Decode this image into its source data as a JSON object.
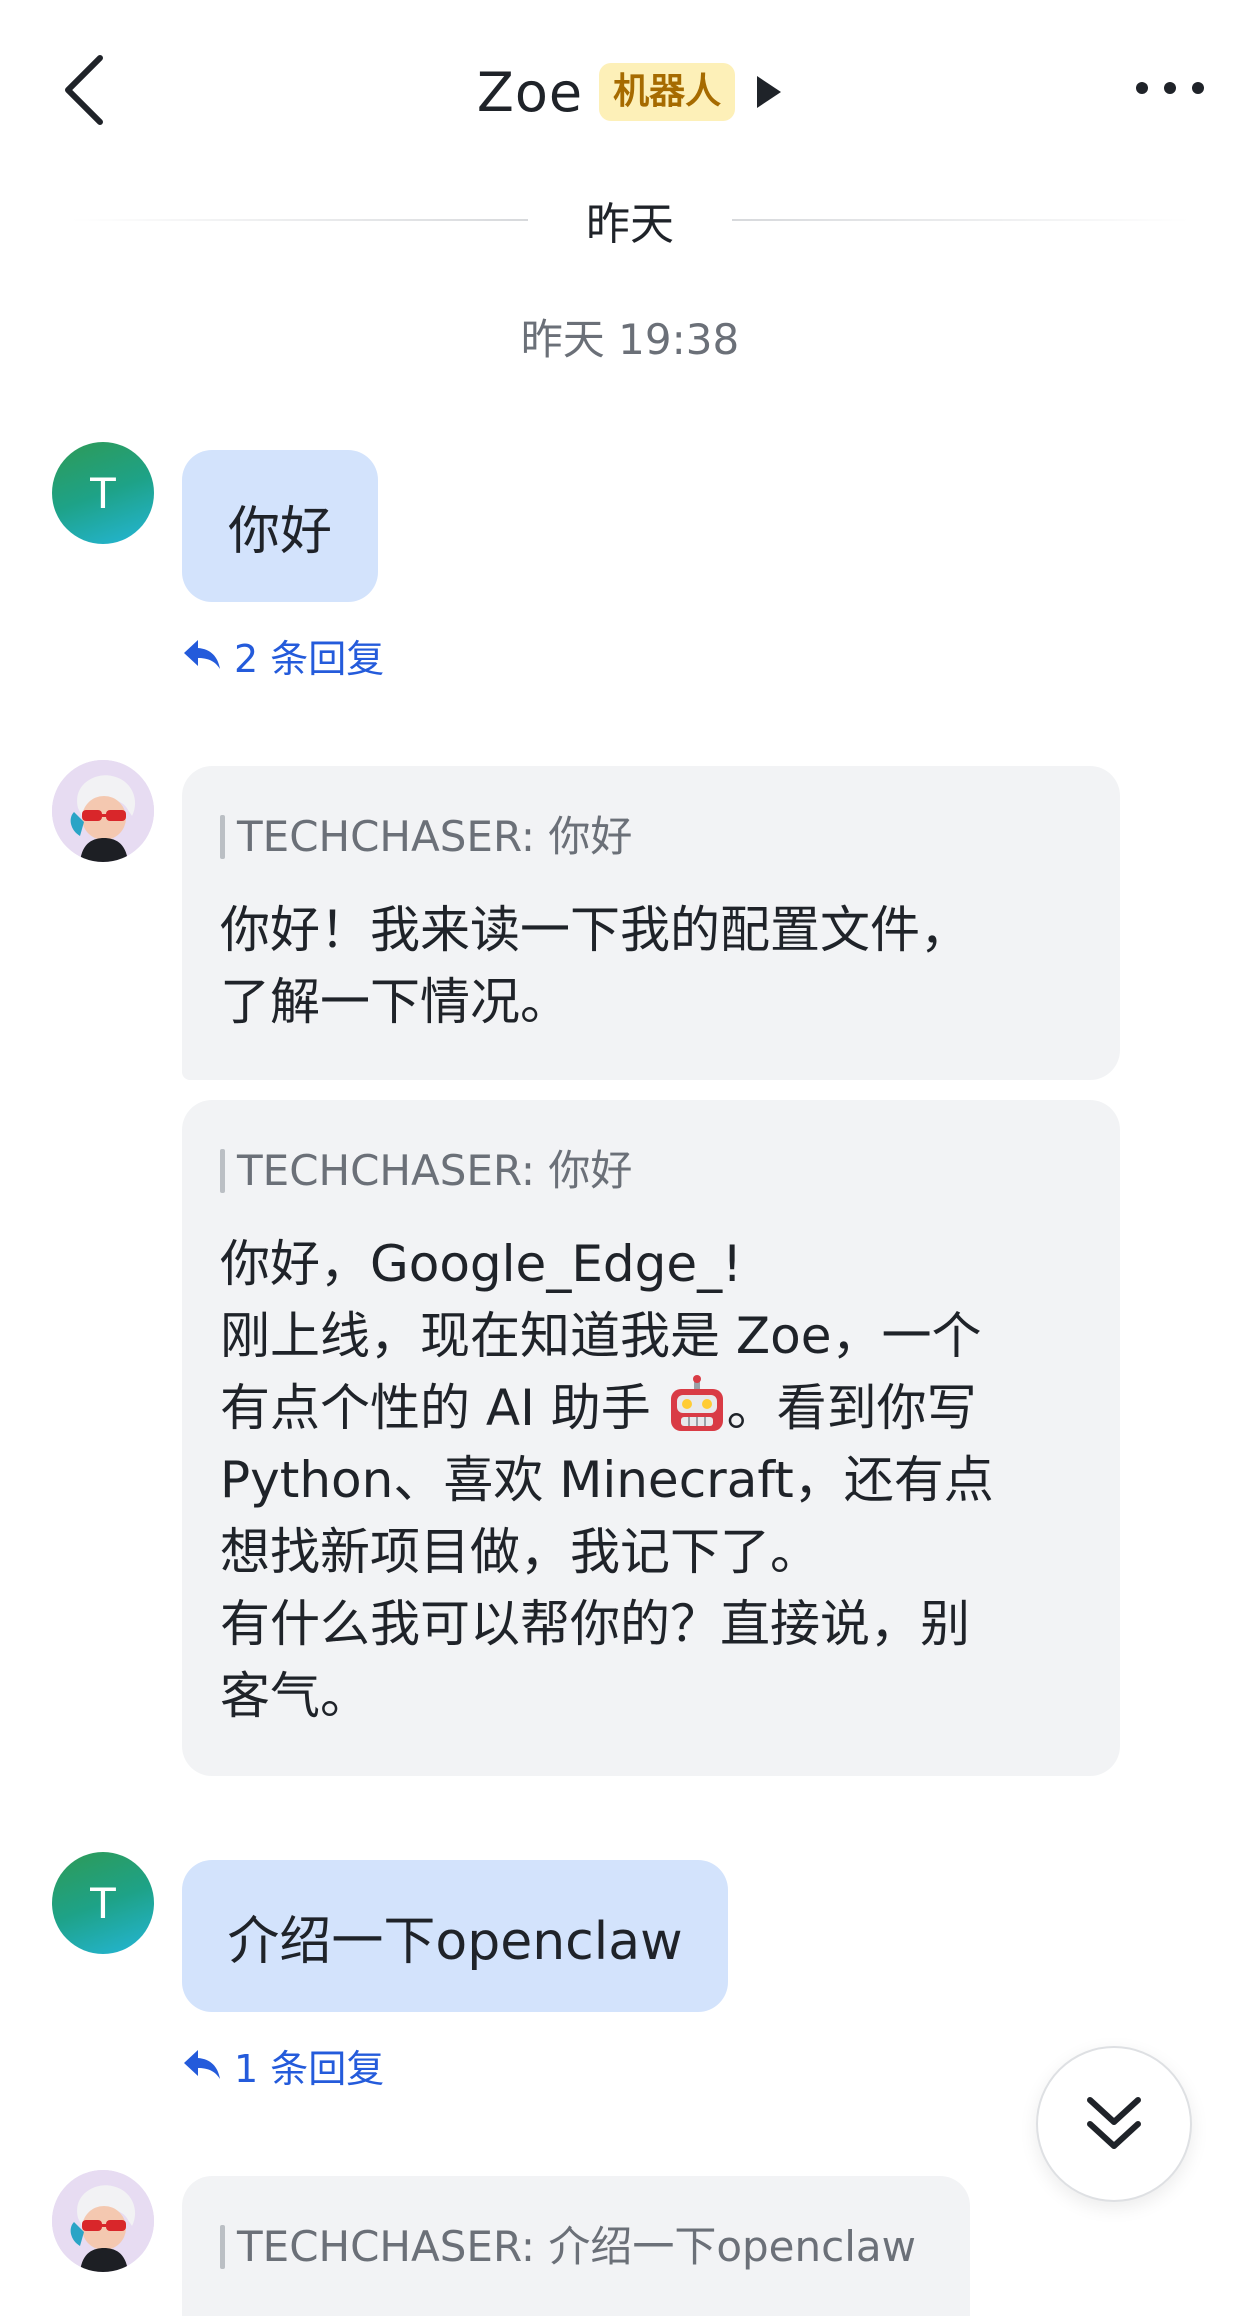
{
  "header": {
    "back_icon": "chevron-left-icon",
    "title": "Zoe",
    "badge": "机器人",
    "play_icon": "triangle-right-icon",
    "more_icon": "more-dots-icon"
  },
  "date_divider": "昨天",
  "timestamp": "昨天 19:38",
  "messages": [
    {
      "sender": "user",
      "avatar_initial": "T",
      "text": "你好",
      "reply_count": "2 条回复"
    },
    {
      "sender": "bot",
      "quote": "TECHCHASER: 你好",
      "lines": [
        "你好！我来读一下我的配置文件，",
        "了解一下情况。"
      ]
    },
    {
      "sender": "bot",
      "quote": "TECHCHASER: 你好",
      "lines": [
        "你好，Google_Edge_!",
        "刚上线，现在知道我是 Zoe，一个",
        "有点个性的 AI 助手",
        "。看到你写",
        "Python、喜欢 Minecraft，还有点",
        "想找新项目做，我记下了。",
        "有什么我可以帮你的？直接说，别",
        "客气。"
      ],
      "emoji": "robot-face-emoji"
    },
    {
      "sender": "user",
      "avatar_initial": "T",
      "text": "介绍一下openclaw",
      "reply_count": "1 条回复"
    },
    {
      "sender": "bot",
      "quote": "TECHCHASER: 介绍一下openclaw"
    }
  ],
  "scroll_button_icon": "double-chevron-down-icon",
  "colors": {
    "user_bubble": "#d3e3fc",
    "bot_bubble": "#f2f3f5",
    "link": "#245bdb",
    "badge_bg": "#fdf0b8",
    "badge_text": "#a66b00"
  }
}
